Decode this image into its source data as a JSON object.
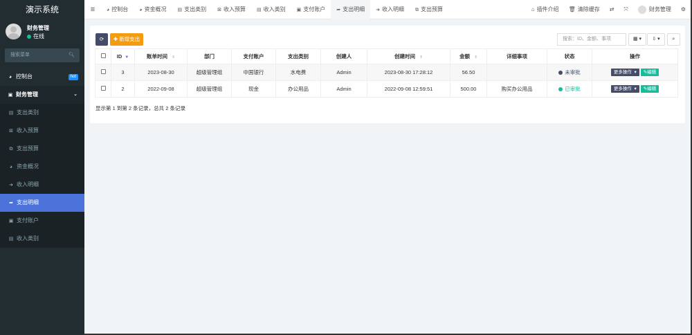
{
  "app": {
    "title": "演示系统"
  },
  "user": {
    "name": "财务管理",
    "status": "在线",
    "status_color": "#18bc9c"
  },
  "sidebar": {
    "search_placeholder": "搜索菜单",
    "items": [
      {
        "label": "控制台",
        "badge": "hot",
        "icon": "dashboard-icon"
      },
      {
        "label": "财务管理",
        "icon": "money-icon"
      }
    ],
    "sub": [
      {
        "label": "支出类别",
        "icon": "list-icon"
      },
      {
        "label": "收入预算",
        "icon": "budget-icon"
      },
      {
        "label": "支出预算",
        "icon": "budget-icon"
      },
      {
        "label": "资金概况",
        "icon": "dashboard-icon"
      },
      {
        "label": "收入明细",
        "icon": "sign-in-icon"
      },
      {
        "label": "支出明细",
        "icon": "sign-out-icon"
      },
      {
        "label": "支付账户",
        "icon": "account-icon"
      },
      {
        "label": "收入类别",
        "icon": "list-icon"
      }
    ]
  },
  "tabs": [
    {
      "label": "控制台"
    },
    {
      "label": "资金概况"
    },
    {
      "label": "支出类别"
    },
    {
      "label": "收入预算"
    },
    {
      "label": "收入类别"
    },
    {
      "label": "支付账户"
    },
    {
      "label": "支出明细"
    },
    {
      "label": "收入明细"
    },
    {
      "label": "支出预算"
    }
  ],
  "header_right": {
    "plugins": "插件介绍",
    "clear_cache": "清除缓存",
    "user": "财务管理"
  },
  "toolbar": {
    "add_label": "新增支出",
    "search_placeholder": "搜索：ID、金额、事项"
  },
  "table": {
    "columns": [
      "ID",
      "账单时间",
      "部门",
      "支付账户",
      "支出类别",
      "创建人",
      "创建时间",
      "金额",
      "详细事项",
      "状态",
      "操作"
    ],
    "rows": [
      {
        "id": "3",
        "date": "2023-08-30",
        "dept": "超级管理组",
        "account": "中国银行",
        "category": "水电费",
        "creator": "Admin",
        "created": "2023-08-30 17:28:12",
        "amount": "56.50",
        "detail": "",
        "status": "未审批",
        "status_color": "#444c69",
        "more": "更多操作",
        "edit": "编辑"
      },
      {
        "id": "2",
        "date": "2022-09-08",
        "dept": "超级管理组",
        "account": "现金",
        "category": "办公用品",
        "creator": "Admin",
        "created": "2022-09-08 12:59:51",
        "amount": "500.00",
        "detail": "购买办公用品",
        "status": "已审批",
        "status_color": "#18bc9c",
        "more": "更多操作",
        "edit": "编辑"
      }
    ]
  },
  "pagination": {
    "info": "显示第 1 到第 2 条记录，总共 2 条记录"
  }
}
